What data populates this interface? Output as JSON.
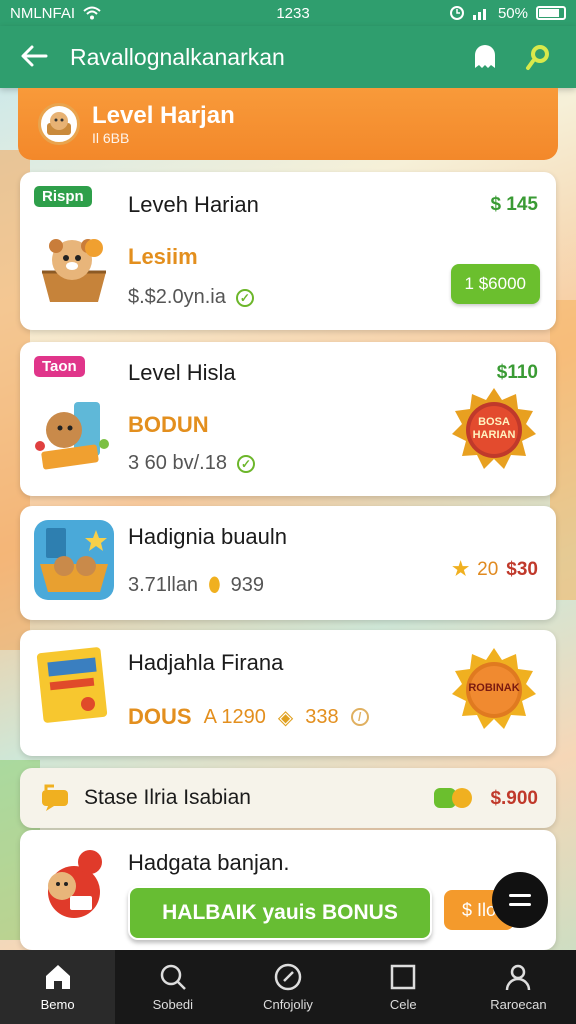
{
  "status_bar": {
    "carrier": "NMLNFAI",
    "time": "1233",
    "battery": "50%"
  },
  "app_bar": {
    "title": "Ravallognalkanarkan"
  },
  "banner": {
    "title": "Level Harjan",
    "subtitle": "Il 6BB"
  },
  "cards": [
    {
      "tag": "Rispn",
      "title": "Leveh Harian",
      "subtitle": "Lesiim",
      "meta": "$.$2.0yn.ia",
      "price": "$ 145",
      "button": "1 $6000"
    },
    {
      "tag": "Taon",
      "title": "Level Hisla",
      "subtitle": "BODUN",
      "meta": "3 60 bv/.18",
      "price": "$110",
      "badge": "BOSA HARIAN"
    },
    {
      "title": "Hadignia buauln",
      "meta": "3.71llan",
      "meta_count": "939",
      "price": "$30",
      "rating": "20"
    },
    {
      "title": "Hadjahla Firana",
      "subtitle": "DOUS",
      "meta_value": "A 1290",
      "meta_count": "338",
      "badge": "ROBINAK"
    },
    {
      "title": "Stase Ilria Isabian",
      "price": "$.900"
    },
    {
      "title": "Hadgata banjan."
    }
  ],
  "bonus_button": "HALBAIK yauis BONUS",
  "orange_chip": "$ Ilo",
  "bottom_nav": [
    {
      "label": "Bemo",
      "icon": "home-icon"
    },
    {
      "label": "Sobedi",
      "icon": "search-icon"
    },
    {
      "label": "Cnfojoliy",
      "icon": "compass-icon"
    },
    {
      "label": "Cele",
      "icon": "square-icon"
    },
    {
      "label": "Raroecan",
      "icon": "user-icon"
    }
  ],
  "colors": {
    "primary": "#2f9e6e",
    "banner": "#f3882a",
    "accent_green": "#6bbf2e",
    "price_green": "#3a9b34",
    "price_red": "#c0392b"
  }
}
